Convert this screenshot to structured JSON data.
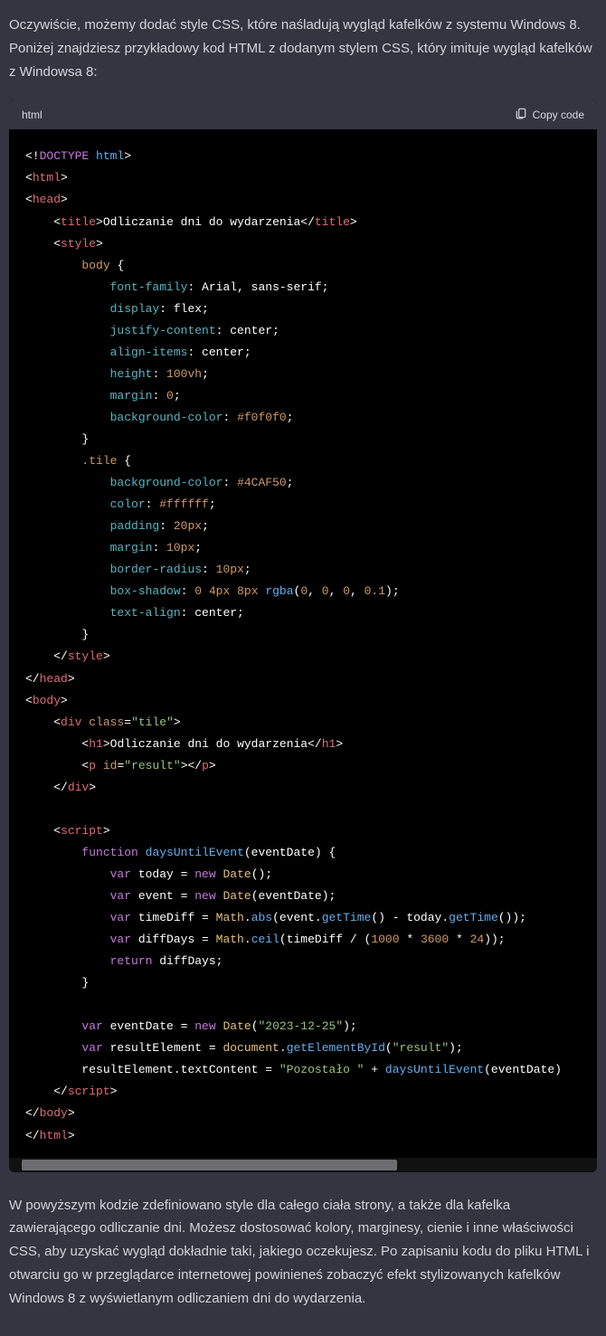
{
  "intro_paragraph": "Oczywiście, możemy dodać style CSS, które naśladują wygląd kafelków z systemu Windows 8. Poniżej znajdziesz przykładowy kod HTML z dodanym stylem CSS, który imituje wygląd kafelków z Windowsa 8:",
  "code_lang_label": "html",
  "copy_label": "Copy code",
  "outro_paragraph": "W powyższym kodzie zdefiniowano style dla całego ciała strony, a także dla kafelka zawierającego odliczanie dni. Możesz dostosować kolory, marginesy, cienie i inne właściwości CSS, aby uzyskać wygląd dokładnie taki, jakiego oczekujesz. Po zapisaniu kodu do pliku HTML i otwarciu go w przeglądarce internetowej powinieneś zobaczyć efekt stylizowanych kafelków Windows 8 z wyświetlanym odliczaniem dni do wydarzenia.",
  "code": {
    "doctype": "<!DOCTYPE html>",
    "tags": {
      "html_open": "<html>",
      "html_close": "</html>",
      "head_open": "<head>",
      "head_close": "</head>",
      "title_open": "<title>",
      "title_text": "Odliczanie dni do wydarzenia",
      "title_close": "</title>",
      "style_open": "<style>",
      "style_close": "</style>",
      "body_open": "<body>",
      "body_close": "</body>",
      "div_open_a": "<div ",
      "div_open_b": ">",
      "div_close": "</div>",
      "h1_open": "<h1>",
      "h1_text": "Odliczanie dni do wydarzenia",
      "h1_close": "</h1>",
      "p_open_a": "<p ",
      "p_open_b": ">",
      "p_close": "</p>",
      "script_open": "<script>",
      "script_close": "</script>"
    },
    "attrs": {
      "class": "class",
      "id": "id",
      "class_val": "\"tile\"",
      "id_val": "\"result\""
    },
    "css": {
      "sel_body": "body",
      "sel_tile": ".tile",
      "font_family_p": "font-family",
      "font_family_v": ": Arial, sans-serif;",
      "display_p": "display",
      "display_v": ": flex;",
      "justify_p": "justify-content",
      "justify_v": ": center;",
      "align_p": "align-items",
      "align_v": ": center;",
      "height_p": "height",
      "height_v1": ": ",
      "height_v2": "100vh",
      "height_v3": ";",
      "margin_p": "margin",
      "margin_v1": ": ",
      "margin_v2": "0",
      "margin_v3": ";",
      "bg_p": "background-color",
      "bg_v1": ": ",
      "bg_v2": "#f0f0f0",
      "bg_v3": ";",
      "tile_bg_v2": "#4CAF50",
      "color_p": "color",
      "color_v2": "#ffffff",
      "padding_p": "padding",
      "padding_v2": "20px",
      "margin2_v2": "10px",
      "radius_p": "border-radius",
      "radius_v2": "10px",
      "shadow_p": "box-shadow",
      "shadow_v_a": ": ",
      "shadow_v_b": "0",
      "shadow_v_c": " ",
      "shadow_v_d": "4px",
      "shadow_v_e": " ",
      "shadow_v_f": "8px",
      "shadow_v_g": " ",
      "shadow_rgba": "rgba",
      "shadow_args_open": "(",
      "shadow_n0": "0",
      "shadow_sep": ", ",
      "shadow_alpha": "0.1",
      "shadow_args_close": ");",
      "talign_p": "text-align",
      "talign_v": ": center;"
    },
    "js": {
      "fn_kw": "function",
      "fn_name": "daysUntilEvent",
      "fn_params": "(eventDate) {",
      "var_kw": "var",
      "today": " today = ",
      "new_kw": "new",
      "date_cls": "Date",
      "paren_empty": "();",
      "event_assign": " event = ",
      "date_arg": "(eventDate);",
      "timediff_assign": " timeDiff = ",
      "math_cls": "Math",
      "dot": ".",
      "abs_fn": "abs",
      "abs_inner_a": "(event.",
      "gettime_fn": "getTime",
      "abs_inner_b": "() - today.",
      "abs_inner_c": "());",
      "diffdays_assign": " diffDays = ",
      "ceil_fn": "ceil",
      "ceil_inner_a": "(timeDiff / (",
      "n1000": "1000",
      "times": " * ",
      "n3600": "3600",
      "n24": "24",
      "ceil_close": "));",
      "return_kw": "return",
      "return_rest": " diffDays;",
      "brace_close": "}",
      "evdate_assign": " eventDate = ",
      "date_str": "\"2023-12-25\"",
      "date_str_close": ");",
      "reselem_assign": " resultElement = ",
      "document_obj": "document",
      "getbyid_fn": "getElementById",
      "getbyid_arg": "(",
      "result_str": "\"result\"",
      "getbyid_close": ");",
      "textcontent_a": "resultElement.textContent = ",
      "pozostalo_str": "\"Pozostało \"",
      "plus": " + ",
      "call_close": "(eventDate)"
    }
  }
}
